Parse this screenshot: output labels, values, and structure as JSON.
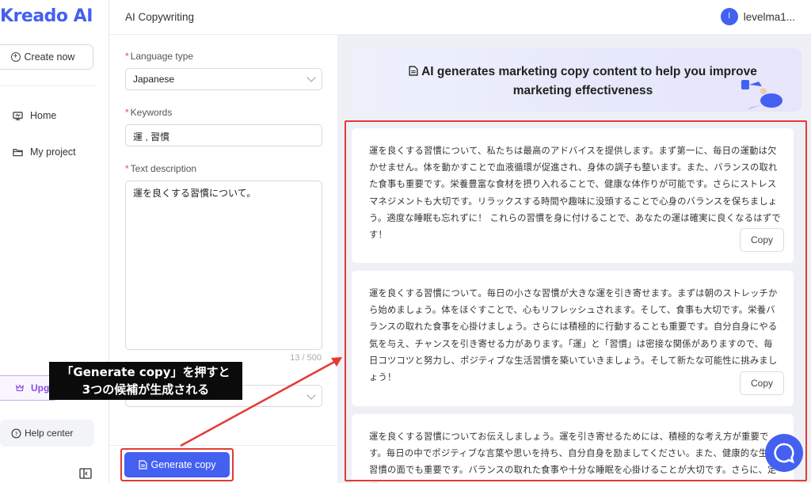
{
  "sidebar": {
    "logo": "Kreado AI",
    "create_label": "Create now",
    "items": [
      {
        "label": "Home",
        "icon": "monitor-icon"
      },
      {
        "label": "My project",
        "icon": "folder-icon"
      }
    ],
    "upgrade_label": "Upg",
    "help_label": "Help center"
  },
  "header": {
    "title": "AI Copywriting",
    "user_initial": "l",
    "user_name": "levelma1..."
  },
  "form": {
    "language_label": "Language type",
    "language_value": "Japanese",
    "keywords_label": "Keywords",
    "keywords_value": "運 , 習慣",
    "description_label": "Text description",
    "description_value": "運を良くする習慣について。",
    "counter": "13 / 500",
    "generate_label": "Generate copy"
  },
  "results": {
    "banner": "AI generates marketing copy content to help you improve marketing effectiveness",
    "cards": [
      {
        "text": "運を良くする習慣について、私たちは最高のアドバイスを提供します。まず第一に、毎日の運動は欠かせません。体を動かすことで血液循環が促進され、身体の調子も整います。また、バランスの取れた食事も重要です。栄養豊富な食材を摂り入れることで、健康な体作りが可能です。さらにストレスマネジメントも大切です。リラックスする時間や趣味に没頭することで心身のバランスを保ちましょう。適度な睡眠も忘れずに！ これらの習慣を身に付けることで、あなたの運は確実に良くなるはずです！",
        "copy_label": "Copy"
      },
      {
        "text": "運を良くする習慣について。毎日の小さな習慣が大きな運を引き寄せます。まずは朝のストレッチから始めましょう。体をほぐすことで、心もリフレッシュされます。そして、食事も大切です。栄養バランスの取れた食事を心掛けましょう。さらには積極的に行動することも重要です。自分自身にやる気を与え、チャンスを引き寄せる力があります。「運」と「習慣」は密接な関係がありますので、毎日コツコツと努力し、ポジティブな生活習慣を築いていきましょう。そして新たな可能性に挑みましょう！",
        "copy_label": "Copy"
      },
      {
        "text": "運を良くする習慣についてお伝えしましょう。運を引き寄せるためには、積極的な考え方が重要です。毎日の中でポジティブな言葉や思いを持ち、自分自身を励ましてください。また、健康的な生活習慣の面でも重要です。バランスの取れた食事や十分な睡眠を心掛けることが大切です。さらに、定期",
        "copy_label": "Copy"
      }
    ]
  },
  "annotation": {
    "line1": "「Generate copy」を押すと",
    "line2": "3つの候補が生成される"
  },
  "colors": {
    "accent": "#4460f1",
    "highlight": "#e53935"
  }
}
